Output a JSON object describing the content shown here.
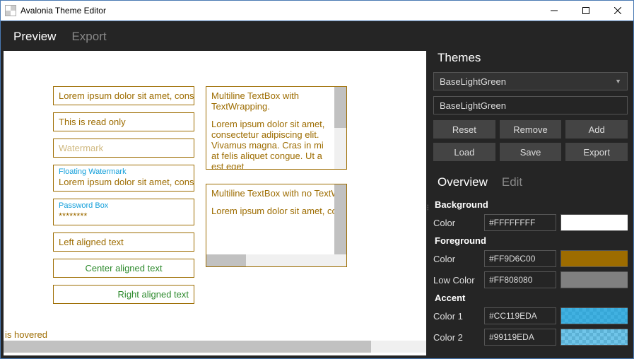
{
  "window": {
    "title": "Avalonia Theme Editor"
  },
  "main_tabs": {
    "preview": "Preview",
    "export": "Export"
  },
  "preview": {
    "lorem_single": "Lorem ipsum dolor sit amet, consectetur",
    "readonly": "This is read only",
    "watermark": "Watermark",
    "floating_label": "Floating Watermark",
    "floating_value": "Lorem ipsum dolor sit amet, consectetur",
    "password_label": "Password Box",
    "password_value": "********",
    "left": "Left aligned text",
    "center": "Center aligned text",
    "right": "Right aligned text",
    "multi1_a": "Multiline TextBox with TextWrapping.",
    "multi1_b": "Lorem ipsum dolor sit amet, consectetur adipiscing elit. Vivamus magna. Cras in mi at felis aliquet congue. Ut a est eget",
    "multi2_a": "Multiline TextBox with no TextWrapping.",
    "multi2_b": "Lorem ipsum dolor sit amet, consectetur",
    "status": "is hovered"
  },
  "themes": {
    "heading": "Themes",
    "selected": "BaseLightGreen",
    "name": "BaseLightGreen",
    "buttons": {
      "reset": "Reset",
      "remove": "Remove",
      "add": "Add",
      "load": "Load",
      "save": "Save",
      "export": "Export"
    }
  },
  "detail_tabs": {
    "overview": "Overview",
    "edit": "Edit"
  },
  "props": {
    "background_h": "Background",
    "foreground_h": "Foreground",
    "accent_h": "Accent",
    "color_l": "Color",
    "lowcolor_l": "Low Color",
    "color1_l": "Color 1",
    "color2_l": "Color 2",
    "bg_color": "#FFFFFFFF",
    "fg_color": "#FF9D6C00",
    "fg_low": "#FF808080",
    "accent1": "#CC119EDA",
    "accent2": "#99119EDA"
  },
  "swatches": {
    "bg": "#FFFFFF",
    "fg": "#9D6C00",
    "fg_low": "#808080",
    "accent": "#119EDA"
  }
}
